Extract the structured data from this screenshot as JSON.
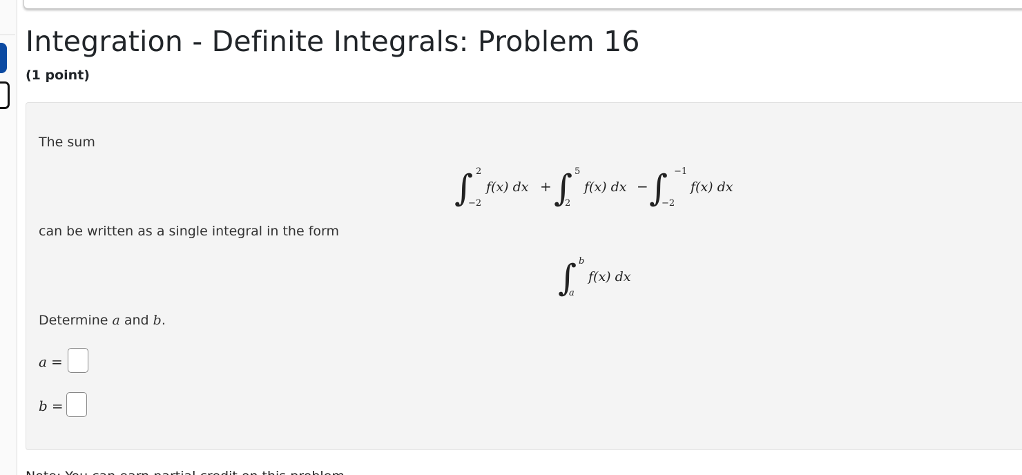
{
  "problem": {
    "title": "Integration - Definite Integrals: Problem 16",
    "points": "(1 point)"
  },
  "statement": {
    "line1": "The sum",
    "line2": "can be written as a single integral in the form",
    "determine_prefix": "Determine ",
    "determine_var_a": "a",
    "determine_mid": " and ",
    "determine_var_b": "b",
    "determine_suffix": "."
  },
  "display_math_1": {
    "term1": {
      "lower": "−2",
      "upper": "2",
      "integrand": "f(x) dx"
    },
    "op1": "+",
    "term2": {
      "lower": "2",
      "upper": "5",
      "integrand": "f(x) dx"
    },
    "op2": "−",
    "term3": {
      "lower": "−2",
      "upper": "−1",
      "integrand": "f(x) dx"
    }
  },
  "display_math_2": {
    "lower": "a",
    "upper": "b",
    "integrand": "f(x) dx"
  },
  "answers": [
    {
      "var": "a",
      "equals": "=",
      "value": ""
    },
    {
      "var": "b",
      "equals": "=",
      "value": ""
    }
  ],
  "note": "Note: You can earn partial credit on this problem."
}
